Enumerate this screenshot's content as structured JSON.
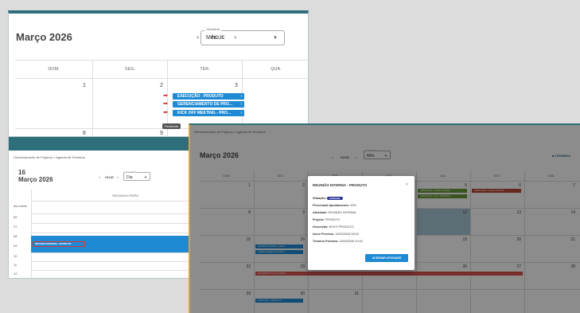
{
  "panel1": {
    "title": "Março 2026",
    "nav": {
      "prev": "<",
      "today": "HOJE",
      "next": ">"
    },
    "view_label": "Visualizar",
    "view_value": "Mês",
    "weekdays": [
      "DOM.",
      "SEG.",
      "TER.",
      "QUA."
    ],
    "days_row1": [
      "1",
      "2",
      "3"
    ],
    "days_row2": [
      "8",
      "9"
    ],
    "events": [
      "EXECUÇÃO - PRODUTO",
      "GERENCIAMENTO DE PRO...",
      "KICK OFF MEETING - PRO..."
    ],
    "tooltip": "Pendente"
  },
  "panel2": {
    "breadcrumb": "Gerenciamento de Projetos  >  Agenda de Terceiros",
    "day": "16",
    "month": "Março 2026",
    "nav": {
      "prev": "<",
      "today": "HOJE",
      "next": ">"
    },
    "view_label": "Visualizar",
    "view_value": "Dia",
    "column_header": "SEGUNDA-FEIRA",
    "allday": "dia inteiro",
    "hours": [
      "06",
      "07",
      "08",
      "09",
      "10",
      "11",
      "12"
    ],
    "event": "REUNIÃO INTERNA - PRODUTO"
  },
  "panel3": {
    "breadcrumb": "Gerenciamento de Projetos  >  Agenda de Terceiros",
    "title": "Março 2026",
    "nav": {
      "prev": "<",
      "today": "HOJE",
      "next": ">"
    },
    "view_label": "Visualizar",
    "view_value": "Mês",
    "legend": "LEGENDA",
    "weekdays": [
      "DOM.",
      "SEG.",
      "TER.",
      "QUA.",
      "QUI.",
      "SEX.",
      "SÁB."
    ],
    "weeks": [
      [
        "1",
        "2",
        "3",
        "4",
        "5",
        "6",
        "7"
      ],
      [
        "8",
        "9",
        "10",
        "11",
        "12",
        "13",
        "14"
      ],
      [
        "15",
        "16",
        "17",
        "18",
        "19",
        "20",
        "21"
      ],
      [
        "22",
        "23",
        "24",
        "25",
        "26",
        "27",
        "28"
      ],
      [
        "29",
        "30",
        "31",
        "",
        "",
        "",
        ""
      ]
    ],
    "cell_events": {
      "w1_thu": "SIMULAÇÃO - LIGAR OS PRIM...",
      "w1_thu2": "SIMULAÇÃO - ALV... PRODUTO",
      "w1_fri": "SIMULAÇÃO - LIGAR OS PRIM...",
      "w3_mon1": "REUNIÃO INTERNA - PROD...",
      "w3_mon2": "GERENCIAMENTO DE PRO...",
      "w4_bar": "ATENDIMENTO DO CLIENTE",
      "w5_mon": "EXECUÇÃO - PRODUTO"
    },
    "modal": {
      "title": "REUNIÃO INTERNA - PRODUTO",
      "close": "×",
      "status_label": "Situação:",
      "status_value": "Atribuído",
      "percent_label": "Percentual Apontamento:",
      "percent_value": "33%",
      "activity_label": "Atividade:",
      "activity_value": "REUNIÃO INTERNA",
      "project_label": "Projeto:",
      "project_value": "PRODUTO",
      "desc_label": "Descrição:",
      "desc_value": "NOVO PRODUTO",
      "start_label": "Início Previsto:",
      "start_value": "16/03/2026 08:00",
      "end_label": "Término Previsto:",
      "end_value": "16/03/2026 10:00",
      "button": "ACESSAR ATIVIDADE"
    }
  }
}
